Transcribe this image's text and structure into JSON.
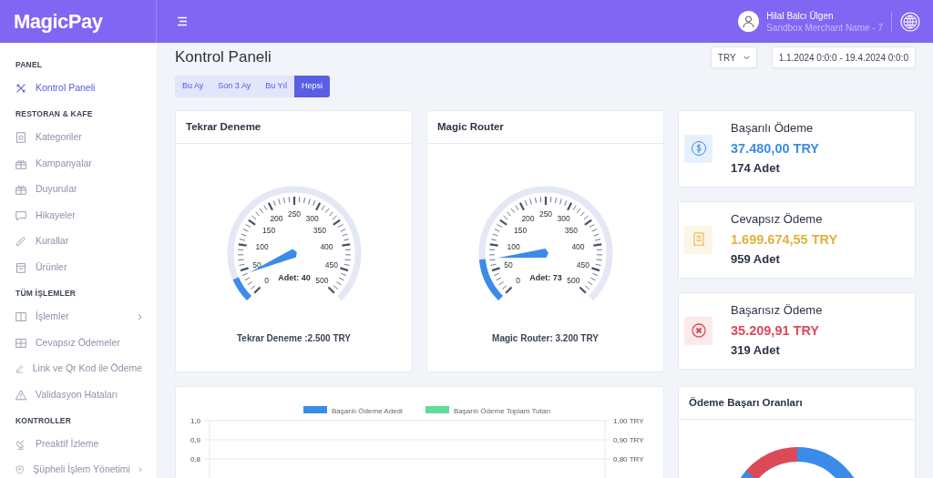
{
  "brand": "MagicPay",
  "header": {
    "user_name": "Hilal Balcı Ülgen",
    "merchant": "Sandbox Merchant Name - 7"
  },
  "sidebar": {
    "sections": [
      {
        "title": "PANEL",
        "items": [
          {
            "label": "Kontrol Paneli",
            "selected": true,
            "expandable": false
          }
        ]
      },
      {
        "title": "RESTORAN & KAFE",
        "items": [
          {
            "label": "Kategoriler",
            "selected": false,
            "expandable": false
          },
          {
            "label": "Kampanyalar",
            "selected": false,
            "expandable": false
          },
          {
            "label": "Duyurular",
            "selected": false,
            "expandable": false
          },
          {
            "label": "Hikayeler",
            "selected": false,
            "expandable": false
          },
          {
            "label": "Kurallar",
            "selected": false,
            "expandable": false
          },
          {
            "label": "Ürünler",
            "selected": false,
            "expandable": false
          }
        ]
      },
      {
        "title": "TÜM İŞLEMLER",
        "items": [
          {
            "label": "İşlemler",
            "selected": false,
            "expandable": true
          },
          {
            "label": "Cevapsız Ödemeler",
            "selected": false,
            "expandable": false
          },
          {
            "label": "Link ve Qr Kod ile Ödeme",
            "selected": false,
            "expandable": false
          },
          {
            "label": "Validasyon Hataları",
            "selected": false,
            "expandable": false
          }
        ]
      },
      {
        "title": "KONTROLLER",
        "items": [
          {
            "label": "Preaktif İzleme",
            "selected": false,
            "expandable": false
          },
          {
            "label": "Şüpheli İşlem Yönetimi",
            "selected": false,
            "expandable": true
          }
        ]
      }
    ]
  },
  "page": {
    "title": "Kontrol Paneli",
    "currency": "TRY",
    "date_range": "1.1.2024 0:0:0 - 19.4.2024 0:0:0",
    "periods": [
      {
        "label": "Bu Ay",
        "selected": false
      },
      {
        "label": "Son 3 Ay",
        "selected": false
      },
      {
        "label": "Bu Yıl",
        "selected": false
      },
      {
        "label": "Hepsi",
        "selected": true
      }
    ]
  },
  "gauges": [
    {
      "title": "Tekrar Deneme",
      "scale": [
        "0",
        "50",
        "100",
        "150",
        "200",
        "250",
        "300",
        "350",
        "400",
        "450",
        "500"
      ],
      "count": "Adet: 40",
      "caption": "Tekrar Deneme :2.500 TRY"
    },
    {
      "title": "Magic Router",
      "scale": [
        "0",
        "50",
        "100",
        "150",
        "200",
        "250",
        "300",
        "350",
        "400",
        "450",
        "500"
      ],
      "count": "Adet: 73",
      "caption": "Magic Router: 3.200 TRY"
    }
  ],
  "stats": [
    {
      "kind": "success",
      "title": "Başarılı Ödeme",
      "amount": "37.480,00 TRY",
      "count": "174 Adet",
      "color": "#3b8beb"
    },
    {
      "kind": "pending",
      "title": "Cevapsız Ödeme",
      "amount": "1.699.674,55 TRY",
      "count": "959 Adet",
      "color": "#e0b23c"
    },
    {
      "kind": "failed",
      "title": "Başarısız Ödeme",
      "amount": "35.209,91 TRY",
      "count": "319 Adet",
      "color": "#dc4a5a"
    }
  ],
  "chart": {
    "chart_data": {
      "type": "bar",
      "series": [
        {
          "name": "Başarılı Ödeme Adedi",
          "color": "#3b8beb"
        },
        {
          "name": "Başarılı Ödeme Toplam Tutarı",
          "color": "#62dc98"
        }
      ],
      "ylim": [
        0.7,
        1.0
      ],
      "y2lim": [
        0.7,
        1.0
      ],
      "yticks": [
        {
          "value": 1.0,
          "label": "1,0"
        },
        {
          "value": 0.9,
          "label": "0,9"
        },
        {
          "value": 0.8,
          "label": "0,8"
        }
      ],
      "y2ticks": [
        {
          "value": 1.0,
          "label": "1,00 TRY"
        },
        {
          "value": 0.9,
          "label": "0,90 TRY"
        },
        {
          "value": 0.8,
          "label": "0,80 TRY"
        }
      ]
    }
  },
  "donut_card": {
    "title": "Ödeme Başarı Oranları"
  }
}
